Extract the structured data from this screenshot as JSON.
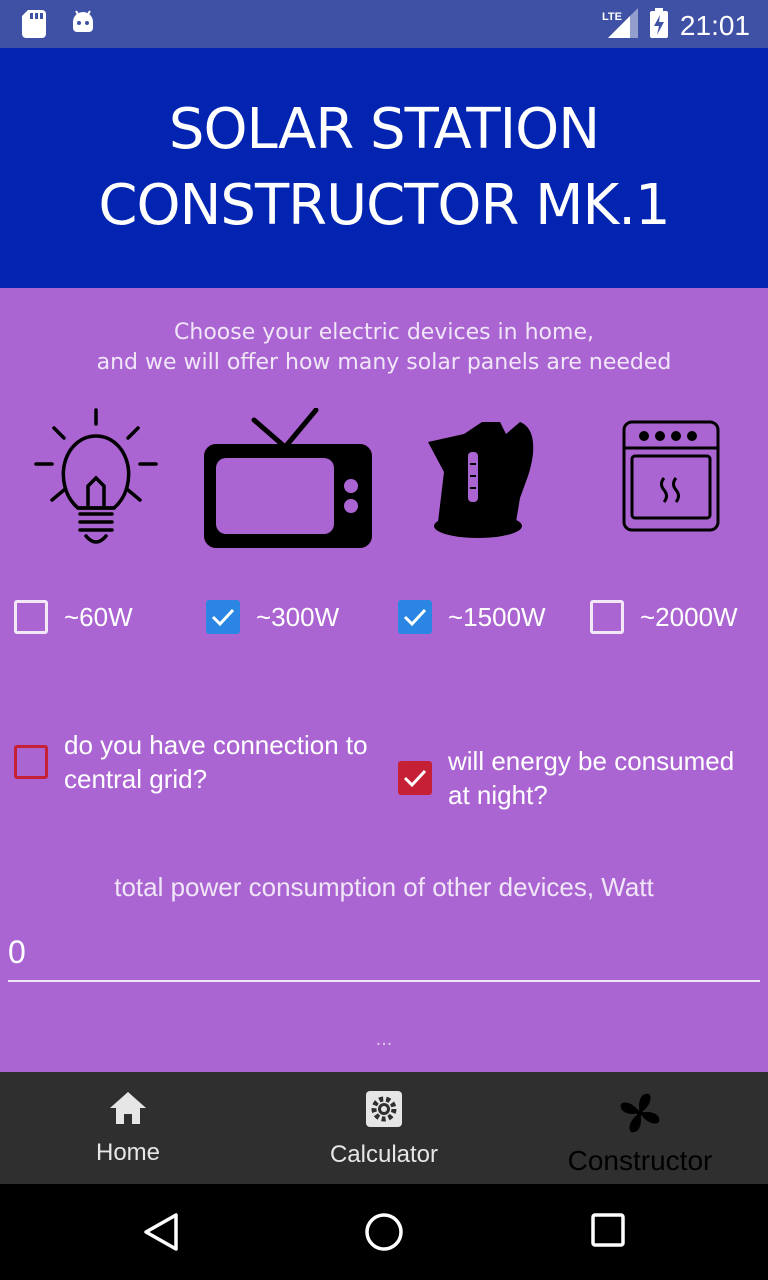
{
  "status_bar": {
    "time": "21:01",
    "network": "LTE",
    "icons": [
      "sd-card-icon",
      "android-icon",
      "lte-signal-icon",
      "battery-charging-icon"
    ]
  },
  "header": {
    "title": "SOLAR STATION CONSTRUCTOR MK.1"
  },
  "intro": {
    "line1": "Choose your electric devices in home,",
    "line2": "and we will offer how many solar panels are needed"
  },
  "devices": [
    {
      "icon": "lightbulb-icon",
      "label": "~60W",
      "checked": false
    },
    {
      "icon": "tv-icon",
      "label": "~300W",
      "checked": true
    },
    {
      "icon": "kettle-icon",
      "label": "~1500W",
      "checked": true
    },
    {
      "icon": "oven-icon",
      "label": "~2000W",
      "checked": false
    }
  ],
  "options": {
    "grid": {
      "label": "do you have connection to central grid?",
      "checked": false
    },
    "night": {
      "label": "will energy be consumed at night?",
      "checked": true
    }
  },
  "other_devices": {
    "label": "total power consumption of other devices, Watt",
    "value": "0"
  },
  "more_indicator": "...",
  "bottom_nav": [
    {
      "icon": "home-icon",
      "label": "Home",
      "active": false
    },
    {
      "icon": "settings-icon",
      "label": "Calculator",
      "active": false
    },
    {
      "icon": "fan-icon",
      "label": "Constructor",
      "active": true
    }
  ],
  "colors": {
    "header_bg": "#0224b0",
    "main_bg": "#ab65d2",
    "checkbox_blue": "#2a86e2",
    "checkbox_red": "#c62036",
    "nav_bg": "#2f2f2f"
  }
}
